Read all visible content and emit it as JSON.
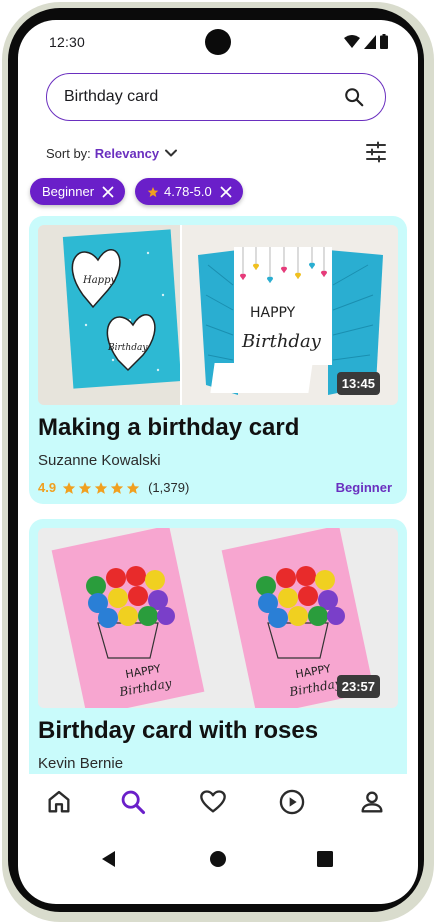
{
  "status": {
    "time": "12:30"
  },
  "search": {
    "query": "Birthday card"
  },
  "sort": {
    "label": "Sort by:",
    "value": "Relevancy"
  },
  "filters": [
    {
      "label": "Beginner",
      "has_star": false
    },
    {
      "label": "4.78-5.0",
      "has_star": true
    }
  ],
  "cards": [
    {
      "title": "Making a birthday card",
      "author": "Suzanne Kowalski",
      "rating": "4.9",
      "rating_count": "(1,379)",
      "level": "Beginner",
      "duration": "13:45",
      "thumb_left_text_1": "Happy",
      "thumb_left_text_2": "Birthday",
      "thumb_right_text_1": "HAPPY",
      "thumb_right_text_2": "Birthday"
    },
    {
      "title": "Birthday card with roses",
      "author": "Kevin Bernie",
      "duration": "23:57",
      "thumb_text_1": "HAPPY",
      "thumb_text_2": "Birthday"
    }
  ],
  "nav": [
    "home-icon",
    "search-icon",
    "heart-icon",
    "play-icon",
    "person-icon"
  ],
  "colors": {
    "accent": "#6a1fc9",
    "card_bg": "#c9fbfb",
    "rating": "#f0a020"
  }
}
